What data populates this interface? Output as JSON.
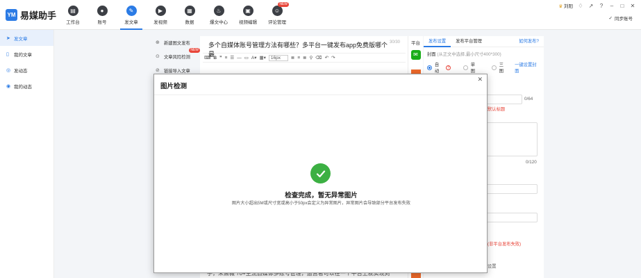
{
  "app": {
    "logo_letter": "YM",
    "name": "易媒助手"
  },
  "nav": [
    {
      "label": "工作台",
      "icon": "workbench-icon"
    },
    {
      "label": "账号",
      "icon": "account-icon"
    },
    {
      "label": "发文章",
      "icon": "compose-icon",
      "active": true
    },
    {
      "label": "发视频",
      "icon": "video-icon"
    },
    {
      "label": "数据",
      "icon": "data-icon"
    },
    {
      "label": "爆文中心",
      "icon": "fire-icon"
    },
    {
      "label": "视频编辑",
      "icon": "video-edit-icon"
    },
    {
      "label": "评论管理",
      "icon": "comment-icon",
      "badge": "NEW"
    }
  ],
  "user": {
    "name": "刘阳",
    "sync_label": "同步账号"
  },
  "sidebar": [
    {
      "label": "发文章",
      "active": true
    },
    {
      "label": "我的文章"
    },
    {
      "label": "发动态"
    },
    {
      "label": "我的动态"
    }
  ],
  "tools": [
    {
      "label": "新建图文发布"
    },
    {
      "label": "文章风险检测",
      "badge": "NEW"
    },
    {
      "label": "链接导入文章"
    }
  ],
  "editor": {
    "title": "多个自媒体账号管理方法有哪些？多平台一键发布app免费版哪个最",
    "title_count": "30/30",
    "font_size": "16px",
    "body_snippet": "手，朱萧薇 70+主流自媒体多账号管理，运营者可以在一个平台上就实现对"
  },
  "platform": {
    "label": "平台"
  },
  "right_panel": {
    "tabs": [
      "发布设置",
      "发布平台管理"
    ],
    "help_link": "如何发布?",
    "cover_label": "封面",
    "cover_hint": "(从正文中选择,最小尺寸400*300)",
    "cover_options": [
      "自动",
      "单图",
      "三图"
    ],
    "set_cover": "一键设置封面",
    "title_count": "0/64",
    "default_title_hint": "默认标题",
    "desc_count": "0/120",
    "fail_hint": "(非平台发布失败)",
    "setting_fragment": "设置"
  },
  "dialog": {
    "title": "图片检测",
    "result": "检查完成，暂无异常图片",
    "note": "图片大小超出5M或尺寸宽或高小于50px会定义为异常图片，异常图片会导致部分平台发布失败"
  },
  "colors": {
    "accent": "#2b7be5",
    "success": "#3cb043",
    "danger": "#e8463a"
  }
}
